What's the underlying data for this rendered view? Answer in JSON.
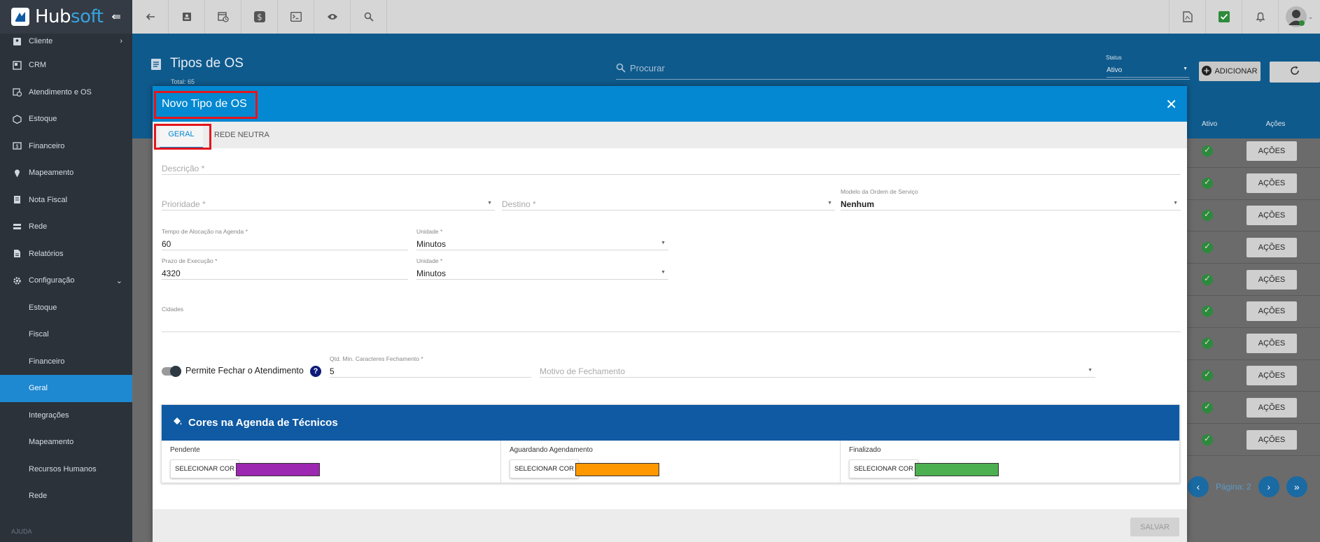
{
  "app": {
    "name": "Hubsoft"
  },
  "sidebar": {
    "items": [
      {
        "label": "Cliente",
        "has_chevron": true
      },
      {
        "label": "CRM"
      },
      {
        "label": "Atendimento e OS"
      },
      {
        "label": "Estoque"
      },
      {
        "label": "Financeiro"
      },
      {
        "label": "Mapeamento"
      },
      {
        "label": "Nota Fiscal"
      },
      {
        "label": "Rede"
      },
      {
        "label": "Relatórios"
      },
      {
        "label": "Configuração",
        "expanded": true
      }
    ],
    "sub_items": [
      {
        "label": "Estoque"
      },
      {
        "label": "Fiscal"
      },
      {
        "label": "Financeiro"
      },
      {
        "label": "Geral",
        "active": true
      },
      {
        "label": "Integrações"
      },
      {
        "label": "Mapeamento"
      },
      {
        "label": "Recursos Humanos"
      },
      {
        "label": "Rede"
      }
    ],
    "footer": "AJUDA"
  },
  "topbar": {
    "left_icons": [
      "back-arrow-icon",
      "contact-card-icon",
      "calendar-clock-icon",
      "dollar-icon",
      "terminal-icon",
      "eye-icon",
      "search-icon"
    ],
    "right_icons": [
      "pdf-icon",
      "checkbox-icon",
      "bell-icon",
      "user-avatar-icon"
    ]
  },
  "page": {
    "title": "Tipos de OS",
    "total": "Total: 65",
    "search_placeholder": "Procurar",
    "status_label": "Status",
    "status_value": "Ativo",
    "add_label": "ADICIONAR",
    "col_active": "Ativo",
    "col_actions": "Ações",
    "row_action": "AÇÕES",
    "row_count": 10,
    "pager_label": "Página: 2"
  },
  "modal": {
    "title": "Novo Tipo de OS",
    "tabs": [
      {
        "label": "GERAL",
        "active": true
      },
      {
        "label": "REDE NEUTRA"
      }
    ],
    "fields": {
      "descricao": "Descrição *",
      "prioridade": "Prioridade *",
      "destino": "Destino *",
      "modelo_label": "Modelo da Ordem de Serviço",
      "modelo_value": "Nenhum",
      "tempo_label": "Tempo de Alocação na Agenda *",
      "tempo_value": "60",
      "unidade1_label": "Unidade *",
      "unidade1_value": "Minutos",
      "prazo_label": "Prazo de Execução *",
      "prazo_value": "4320",
      "unidade2_label": "Unidade *",
      "unidade2_value": "Minutos",
      "cidades_label": "Cidades",
      "permite_label": "Permite Fechar o Atendimento",
      "permite_on": true,
      "qtd_label": "Qtd. Min. Caracteres Fechamento *",
      "qtd_value": "5",
      "motivo_placeholder": "Motivo de Fechamento"
    },
    "colors_panel": {
      "title": "Cores na Agenda de Técnicos",
      "button_label": "SELECIONAR COR",
      "columns": [
        {
          "label": "Pendente",
          "color": "#9c27b0"
        },
        {
          "label": "Aguardando Agendamento",
          "color": "#ff9800"
        },
        {
          "label": "Finalizado",
          "color": "#4caf50"
        }
      ]
    },
    "save_label": "SALVAR"
  }
}
